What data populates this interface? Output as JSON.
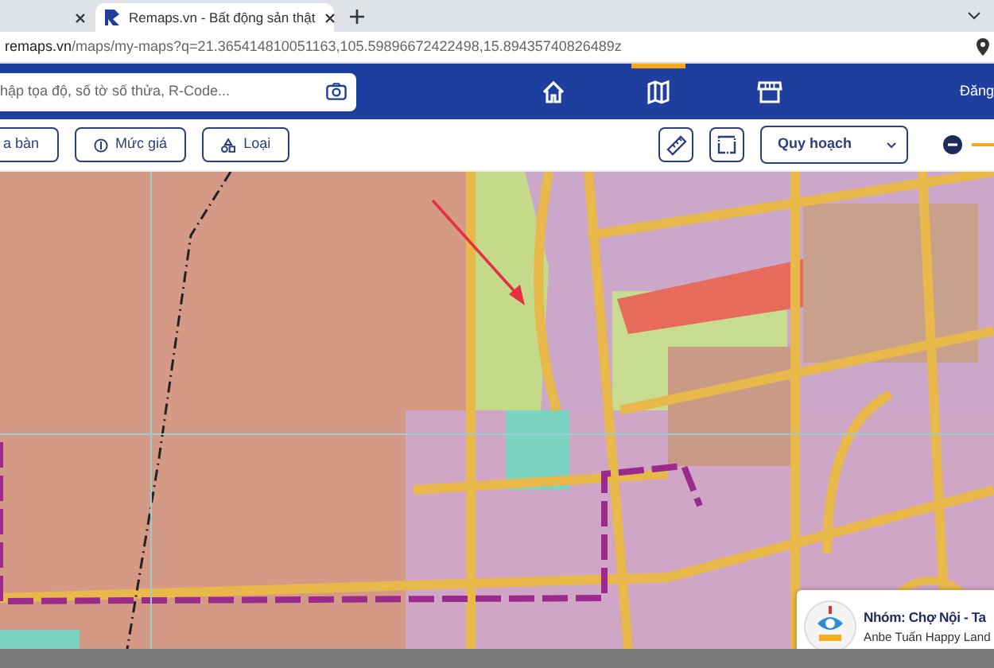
{
  "browser": {
    "tabs": [
      {
        "kind": "partial",
        "selected": false
      },
      {
        "kind": "site",
        "label": "Remaps.vn - Bất động sản thật",
        "selected": true
      }
    ],
    "address": {
      "host": "remaps.vn",
      "path": "/maps/my-maps?q=21.365414810051163,105.59896672422498,15.89435740826489z"
    }
  },
  "header": {
    "search": {
      "placeholder": "hập tọa độ, số tờ số thửa, R-Code..."
    },
    "nav": [
      {
        "kind": "home",
        "selected": false
      },
      {
        "kind": "map",
        "selected": true
      },
      {
        "kind": "store",
        "selected": false
      }
    ],
    "account_label": "Đăng"
  },
  "toolbar": {
    "filters": [
      {
        "kind": "plain",
        "label": "a bàn"
      },
      {
        "kind": "price",
        "label": "Mức giá"
      },
      {
        "kind": "type",
        "label": "Loại"
      }
    ],
    "layer_select": "Quy hoạch",
    "opacity": {
      "level": 1
    }
  },
  "popup": {
    "title": "Nhóm: Chợ Nội - Ta",
    "subtitle": "Anbe Tuấn Happy Land"
  }
}
